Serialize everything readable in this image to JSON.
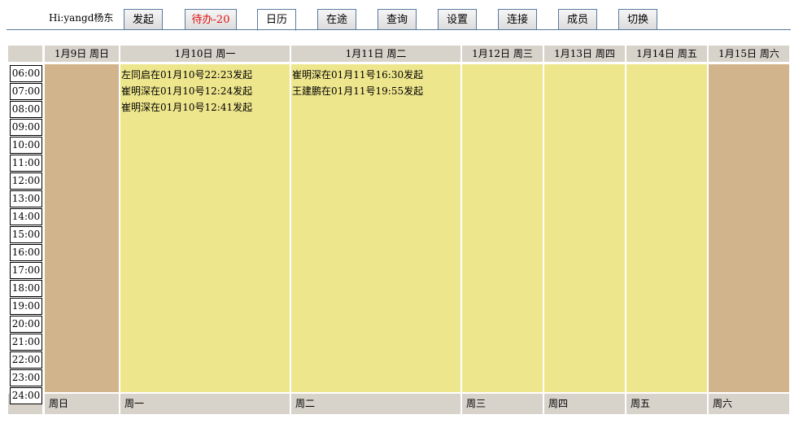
{
  "header": {
    "greeting": "Hi:yangd杨东",
    "tabs": [
      {
        "label": "发起"
      },
      {
        "label": "待办-20"
      },
      {
        "label": "日历"
      },
      {
        "label": "在途"
      },
      {
        "label": "查询"
      },
      {
        "label": "设置"
      },
      {
        "label": "连接"
      },
      {
        "label": "成员"
      },
      {
        "label": "切换"
      }
    ],
    "active_tab": "日历",
    "alert_color": "#e01010"
  },
  "calendar": {
    "days": [
      {
        "heading": "1月9日 周日",
        "footer": "周日",
        "weekend": true,
        "events": []
      },
      {
        "heading": "1月10日 周一",
        "footer": "周一",
        "weekend": false,
        "events": [
          "左同启在01月10号22:23发起",
          "崔明深在01月10号12:24发起",
          "崔明深在01月10号12:41发起"
        ]
      },
      {
        "heading": "1月11日 周二",
        "footer": "周二",
        "weekend": false,
        "events": [
          "崔明深在01月11号16:30发起",
          "王建鹏在01月11号19:55发起"
        ]
      },
      {
        "heading": "1月12日 周三",
        "footer": "周三",
        "weekend": false,
        "events": []
      },
      {
        "heading": "1月13日 周四",
        "footer": "周四",
        "weekend": false,
        "events": []
      },
      {
        "heading": "1月14日 周五",
        "footer": "周五",
        "weekend": false,
        "events": []
      },
      {
        "heading": "1月15日 周六",
        "footer": "周六",
        "weekend": true,
        "events": []
      }
    ],
    "hours": [
      "06:00",
      "07:00",
      "08:00",
      "09:00",
      "10:00",
      "11:00",
      "12:00",
      "13:00",
      "14:00",
      "15:00",
      "16:00",
      "17:00",
      "18:00",
      "19:00",
      "20:00",
      "21:00",
      "22:00",
      "23:00",
      "24:00"
    ],
    "colors": {
      "weekend": "#d2b48c",
      "weekday": "#eee68d",
      "header": "#d7d2ca"
    }
  }
}
